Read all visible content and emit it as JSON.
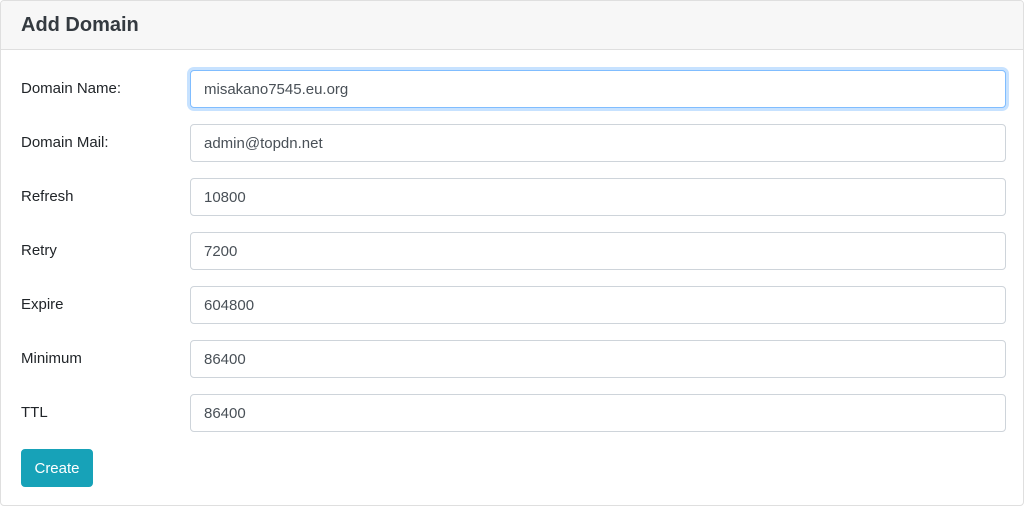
{
  "header": {
    "title": "Add Domain"
  },
  "fields": {
    "domain_name": {
      "label": "Domain Name:",
      "value": "misakano7545.eu.org"
    },
    "domain_mail": {
      "label": "Domain Mail:",
      "value": "admin@topdn.net"
    },
    "refresh": {
      "label": "Refresh",
      "value": "10800"
    },
    "retry": {
      "label": "Retry",
      "value": "7200"
    },
    "expire": {
      "label": "Expire",
      "value": "604800"
    },
    "minimum": {
      "label": "Minimum",
      "value": "86400"
    },
    "ttl": {
      "label": "TTL",
      "value": "86400"
    }
  },
  "actions": {
    "create_label": "Create"
  },
  "colors": {
    "accent": "#17a2b8",
    "focus_border": "#80bdff"
  }
}
